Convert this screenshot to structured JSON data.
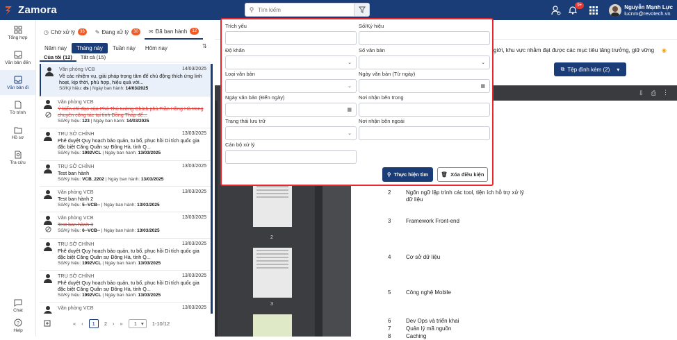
{
  "app": {
    "name": "Zamora"
  },
  "search": {
    "placeholder": "Tìm kiếm"
  },
  "user": {
    "name": "Nguyễn Mạnh Lực",
    "email": "lucnm@revotech.vn",
    "notif_count": "9+"
  },
  "sidebar": {
    "items": [
      {
        "label": "Tổng hợp",
        "icon": "dashboard-icon"
      },
      {
        "label": "Văn bản đến",
        "icon": "inbox-icon"
      },
      {
        "label": "Văn bản đi",
        "icon": "outbox-icon"
      },
      {
        "label": "Tờ trình",
        "icon": "document-icon"
      },
      {
        "label": "Hồ sơ",
        "icon": "folder-icon"
      },
      {
        "label": "Tra cứu",
        "icon": "search-doc-icon"
      }
    ],
    "bottom": [
      {
        "label": "Chat",
        "icon": "chat-icon"
      },
      {
        "label": "Help",
        "icon": "help-icon"
      }
    ]
  },
  "tabs": [
    {
      "label": "Chờ xử lý",
      "count": "33"
    },
    {
      "label": "Đang xử lý",
      "count": "30"
    },
    {
      "label": "Đã ban hành",
      "count": "12"
    }
  ],
  "period": [
    "Năm nay",
    "Tháng này",
    "Tuần này",
    "Hôm nay"
  ],
  "scope": [
    "Của tôi (12)",
    "Tất cả (15)"
  ],
  "list": [
    {
      "org": "Văn phòng VCB",
      "date": "14/03/2025",
      "title": "Về các nhiệm vụ, giải pháp trọng tâm để chủ động thích ứng linh hoạt, kịp thời, phù hợp, hiệu quả với...",
      "meta_prefix": "Số/Ký hiệu: ",
      "code": "ds",
      "issue_label": "Ngày ban hành: ",
      "issue_date": "14/03/2025"
    },
    {
      "org": "Văn phòng VCB",
      "date": "",
      "title": "Ý kiến chỉ đạo của Phó Thủ tướng Chính phủ Trần Hồng Hà trong chuyên công tác tại tỉnh Đồng Tháp để...",
      "meta_prefix": "Số/Ký hiệu: ",
      "code": "123",
      "issue_label": "Ngày ban hành: ",
      "issue_date": "14/03/2025"
    },
    {
      "org": "TRỤ SỞ CHÍNH",
      "date": "13/03/2025",
      "title": "Phê duyệt Quy hoạch bảo quản, tu bổ, phục hồi Di tích quốc gia đặc biệt Căng Quân sự Đông Hà, tỉnh Q...",
      "meta_prefix": "Số/Ký hiệu: ",
      "code": "1992VCL",
      "issue_label": "Ngày ban hành: ",
      "issue_date": "13/03/2025"
    },
    {
      "org": "TRỤ SỞ CHÍNH",
      "date": "13/03/2025",
      "title": "Test ban hành",
      "meta_prefix": "Số/Ký hiệu: ",
      "code": "VCB_2202",
      "issue_label": "Ngày ban hành: ",
      "issue_date": "13/03/2025"
    },
    {
      "org": "Văn phòng VCB",
      "date": "13/03/2025",
      "title": "Test ban hành 2",
      "meta_prefix": "Số/Ký hiệu: ",
      "code": "5--VCB--",
      "issue_label": "Ngày ban hành: ",
      "issue_date": "13/03/2025"
    },
    {
      "org": "Văn phòng VCB",
      "date": "13/03/2025",
      "title": "Test ban hành 3",
      "meta_prefix": "Số/Ký hiệu: ",
      "code": "6--VCB--",
      "issue_label": "Ngày ban hành: ",
      "issue_date": "13/03/2025"
    },
    {
      "org": "TRỤ SỞ CHÍNH",
      "date": "13/03/2025",
      "title": "Phê duyệt Quy hoạch bảo quản, tu bổ, phục hồi Di tích quốc gia đặc biệt Căng Quân sự Đông Hà, tỉnh Q...",
      "meta_prefix": "Số/Ký hiệu: ",
      "code": "1992VCL",
      "issue_label": "Ngày ban hành: ",
      "issue_date": "13/03/2025"
    },
    {
      "org": "TRỤ SỞ CHÍNH",
      "date": "13/03/2025",
      "title": "Phê duyệt Quy hoạch bảo quản, tu bổ, phục hồi Di tích quốc gia đặc biệt Căng Quân sự Đông Hà, tỉnh Q...",
      "meta_prefix": "Số/Ký hiệu: ",
      "code": "1992VCL",
      "issue_label": "Ngày ban hành: ",
      "issue_date": "13/03/2025"
    },
    {
      "org": "Văn phòng VCB",
      "date": "13/03/2025",
      "title": "",
      "meta_prefix": "",
      "code": "",
      "issue_label": "",
      "issue_date": ""
    }
  ],
  "pager": {
    "first": "«",
    "prev": "‹",
    "page1": "1",
    "page2": "2",
    "next": "›",
    "last": "»",
    "size": "1",
    "range": "1-10/12"
  },
  "detail": {
    "snippet": "giới, khu vực nhằm đạt được các mục tiêu tăng trưởng, giữ vững",
    "attach_label": "Tệp đính kèm (2)"
  },
  "viewer": {
    "thumb_labels": [
      "2",
      "3"
    ],
    "items": [
      {
        "n": "2",
        "t": "Ngôn ngữ lập trình các tool, tiện ích hỗ trợ xử lý dữ liệu"
      },
      {
        "n": "3",
        "t": "Framework Front-end"
      },
      {
        "n": "4",
        "t": "Cơ sở dữ liệu"
      },
      {
        "n": "5",
        "t": "Công nghệ Mobile"
      },
      {
        "n": "6",
        "t": "Dev Ops và triển khai"
      },
      {
        "n": "7",
        "t": "Quản lý mã nguồn"
      },
      {
        "n": "8",
        "t": "Caching"
      }
    ]
  },
  "filter": {
    "trich_yeu": "Trích yếu",
    "so_ky_hieu": "Số/Ký hiệu",
    "do_khan": "Độ khẩn",
    "so_van_ban": "Sổ văn bản",
    "loai_van_ban": "Loại văn bản",
    "ngay_tu": "Ngày văn bản (Từ ngày)",
    "ngay_den": "Ngày văn bản (Đến ngày)",
    "noi_nhan_trong": "Nơi nhận bên trong",
    "trang_thai": "Trạng thái lưu trữ",
    "noi_nhan_ngoai": "Nơi nhận bên ngoài",
    "can_bo": "Cán bộ xử lý",
    "btn_search": "Thực hiện tìm",
    "btn_clear": "Xóa điều kiện"
  }
}
